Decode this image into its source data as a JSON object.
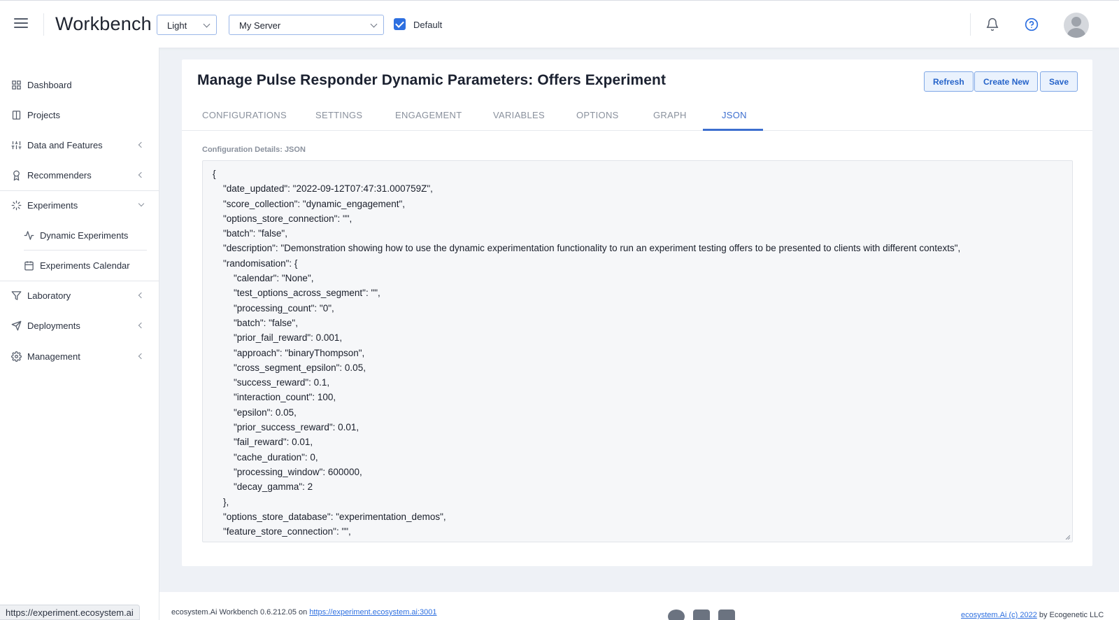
{
  "header": {
    "brand": "Workbench",
    "theme_select": "Light",
    "server_select": "My Server",
    "default_checked": true,
    "default_label": "Default"
  },
  "sidebar": {
    "items": [
      {
        "label": "Dashboard",
        "icon": "grid-icon"
      },
      {
        "label": "Projects",
        "icon": "book-icon"
      },
      {
        "label": "Data and Features",
        "icon": "sliders-icon"
      },
      {
        "label": "Recommenders",
        "icon": "award-icon"
      },
      {
        "label": "Experiments",
        "icon": "loader-icon"
      },
      {
        "label": "Dynamic Experiments",
        "icon": "activity-icon"
      },
      {
        "label": "Experiments Calendar",
        "icon": "calendar-icon"
      },
      {
        "label": "Laboratory",
        "icon": "filter-icon"
      },
      {
        "label": "Deployments",
        "icon": "send-icon"
      },
      {
        "label": "Management",
        "icon": "settings-icon"
      }
    ]
  },
  "main": {
    "title": "Manage Pulse Responder Dynamic Parameters: Offers Experiment",
    "buttons": {
      "refresh": "Refresh",
      "create_new": "Create New",
      "save": "Save"
    },
    "tabs": [
      "CONFIGURATIONS",
      "SETTINGS",
      "ENGAGEMENT",
      "VARIABLES",
      "OPTIONS",
      "GRAPH",
      "JSON"
    ],
    "active_tab": "JSON",
    "field_label": "Configuration Details: JSON",
    "json_lines": [
      "{",
      "    \"date_updated\": \"2022-09-12T07:47:31.000759Z\",",
      "    \"score_collection\": \"dynamic_engagement\",",
      "    \"options_store_connection\": \"\",",
      "    \"batch\": \"false\",",
      "    \"description\": \"Demonstration showing how to use the dynamic experimentation functionality to run an experiment testing offers to be presented to clients with different contexts\",",
      "    \"randomisation\": {",
      "        \"calendar\": \"None\",",
      "        \"test_options_across_segment\": \"\",",
      "        \"processing_count\": \"0\",",
      "        \"batch\": \"false\",",
      "        \"prior_fail_reward\": 0.001,",
      "        \"approach\": \"binaryThompson\",",
      "        \"cross_segment_epsilon\": 0.05,",
      "        \"success_reward\": 0.1,",
      "        \"interaction_count\": 100,",
      "        \"epsilon\": 0.05,",
      "        \"prior_success_reward\": 0.01,",
      "        \"fail_reward\": 0.01,",
      "        \"cache_duration\": 0,",
      "        \"processing_window\": 600000,",
      "        \"decay_gamma\": 2",
      "    },",
      "    \"options_store_database\": \"experimentation_demos\",",
      "    \"feature_store_connection\": \"\","
    ]
  },
  "footer": {
    "version_text": "ecosystem.Ai Workbench 0.6.212.05 on",
    "version_link": "https://experiment.ecosystem.ai:3001",
    "copyright_link": "ecosystem.Ai (c) 2022",
    "copyright_suffix": " by Ecogenetic LLC"
  },
  "statusbar": {
    "url": "https://experiment.ecosystem.ai"
  },
  "colors": {
    "accent": "#2d6fe0",
    "tab_active": "#3d6fcf",
    "background": "#eef1f6"
  }
}
